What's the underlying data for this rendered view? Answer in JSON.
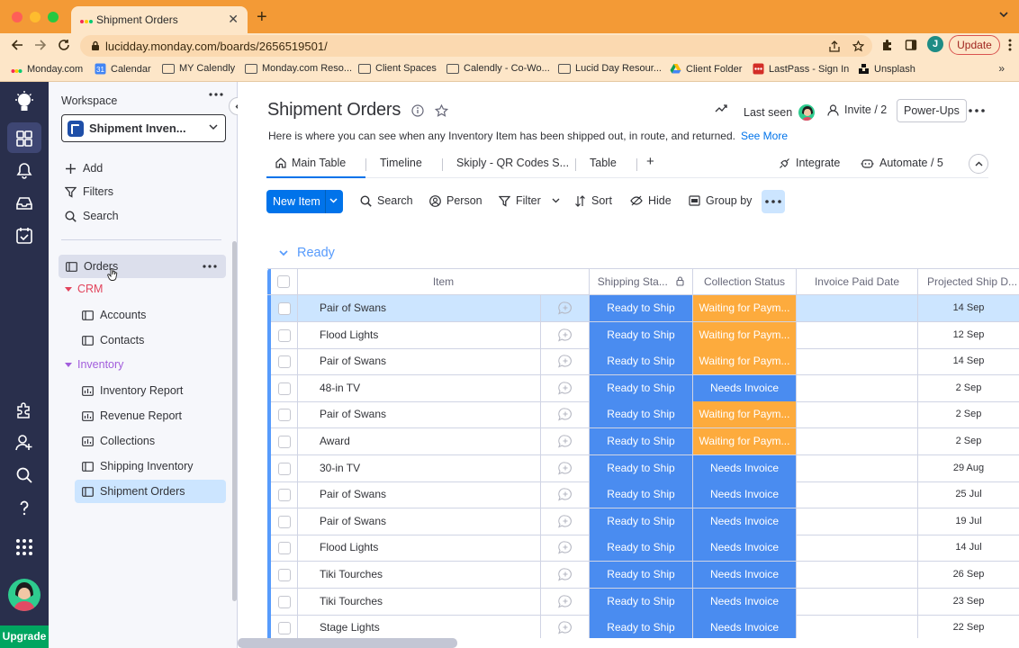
{
  "browser": {
    "tab_title": "Shipment Orders",
    "url": "lucidday.monday.com/boards/2656519501/",
    "profile_initial": "J",
    "update_label": "Update",
    "bookmarks": [
      "Monday.com",
      "Calendar",
      "MY Calendly",
      "Monday.com Reso...",
      "Client Spaces",
      "Calendly - Co-Wo...",
      "Lucid Day Resour...",
      "Client Folder",
      "LastPass - Sign In",
      "Unsplash"
    ],
    "bookmarks_more": "»"
  },
  "rail": {
    "upgrade_label": "Upgrade"
  },
  "sidebar": {
    "workspace_label": "Workspace",
    "workspace_name": "Shipment Inven...",
    "actions": [
      "Add",
      "Filters",
      "Search"
    ],
    "items": {
      "orders": "Orders",
      "crm": "CRM",
      "accounts": "Accounts",
      "contacts": "Contacts",
      "inventory": "Inventory",
      "inventory_report": "Inventory Report",
      "revenue_report": "Revenue Report",
      "collections": "Collections",
      "shipping_inventory": "Shipping Inventory",
      "shipment_orders": "Shipment Orders"
    }
  },
  "board": {
    "title": "Shipment Orders",
    "description": "Here is where you can see when any Inventory Item has been shipped out, in route, and returned.",
    "see_more": "See More",
    "last_seen": "Last seen",
    "invite": "Invite / 2",
    "powerups": "Power-Ups",
    "views": [
      "Main Table",
      "Timeline",
      "Skiply - QR Codes S...",
      "Table"
    ],
    "add_view": "+",
    "integrate": "Integrate",
    "automate": "Automate / 5",
    "toolbar": {
      "new_item": "New Item",
      "search": "Search",
      "person": "Person",
      "filter": "Filter",
      "sort": "Sort",
      "hide": "Hide",
      "group_by": "Group by"
    },
    "group": {
      "title": "Ready",
      "color": "#579bfc",
      "columns": [
        "Item",
        "Shipping Sta...",
        "Collection Status",
        "Invoice Paid Date",
        "Projected Ship D..."
      ],
      "rows": [
        {
          "item": "Pair of Swans",
          "shipping": "Ready to Ship",
          "collection": "Waiting for Paym...",
          "invoice_date": "",
          "ship_date": "14 Sep"
        },
        {
          "item": "Flood Lights",
          "shipping": "Ready to Ship",
          "collection": "Waiting for Paym...",
          "invoice_date": "",
          "ship_date": "12 Sep"
        },
        {
          "item": "Pair of Swans",
          "shipping": "Ready to Ship",
          "collection": "Waiting for Paym...",
          "invoice_date": "",
          "ship_date": "14 Sep"
        },
        {
          "item": "48-in TV",
          "shipping": "Ready to Ship",
          "collection": "Needs Invoice",
          "invoice_date": "",
          "ship_date": "2 Sep"
        },
        {
          "item": "Pair of Swans",
          "shipping": "Ready to Ship",
          "collection": "Waiting for Paym...",
          "invoice_date": "",
          "ship_date": "2 Sep"
        },
        {
          "item": "Award",
          "shipping": "Ready to Ship",
          "collection": "Waiting for Paym...",
          "invoice_date": "",
          "ship_date": "2 Sep"
        },
        {
          "item": "30-in TV",
          "shipping": "Ready to Ship",
          "collection": "Needs Invoice",
          "invoice_date": "",
          "ship_date": "29 Aug"
        },
        {
          "item": "Pair of Swans",
          "shipping": "Ready to Ship",
          "collection": "Needs Invoice",
          "invoice_date": "",
          "ship_date": "25 Jul"
        },
        {
          "item": "Pair of Swans",
          "shipping": "Ready to Ship",
          "collection": "Needs Invoice",
          "invoice_date": "",
          "ship_date": "19 Jul"
        },
        {
          "item": "Flood Lights",
          "shipping": "Ready to Ship",
          "collection": "Needs Invoice",
          "invoice_date": "",
          "ship_date": "14 Jul"
        },
        {
          "item": "Tiki Tourches",
          "shipping": "Ready to Ship",
          "collection": "Needs Invoice",
          "invoice_date": "",
          "ship_date": "26 Sep"
        },
        {
          "item": "Tiki Tourches",
          "shipping": "Ready to Ship",
          "collection": "Needs Invoice",
          "invoice_date": "",
          "ship_date": "23 Sep"
        },
        {
          "item": "Stage Lights",
          "shipping": "Ready to Ship",
          "collection": "Needs Invoice",
          "invoice_date": "",
          "ship_date": "22 Sep"
        }
      ]
    }
  },
  "status_colors": {
    "Ready to Ship": "#4a8cf0",
    "Waiting for Paym...": "#fdab3d",
    "Needs Invoice": "#4a8cf0"
  }
}
